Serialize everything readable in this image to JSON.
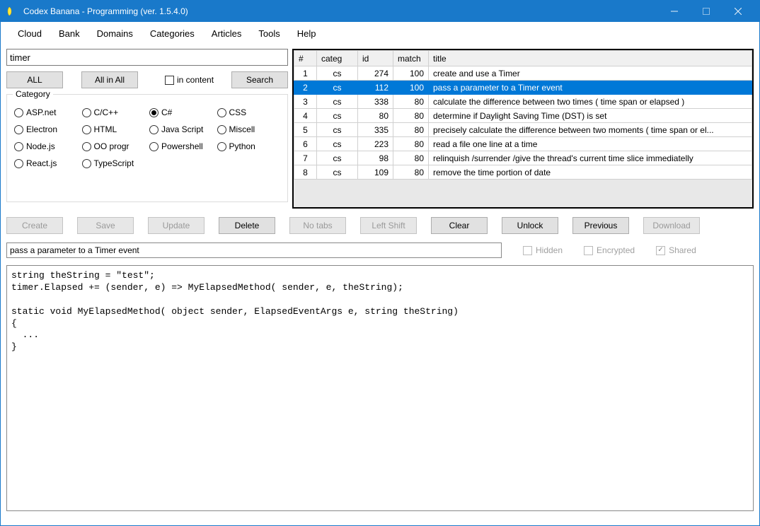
{
  "window": {
    "title": "Codex Banana - Programming  (ver. 1.5.4.0)"
  },
  "menu": [
    "Cloud",
    "Bank",
    "Domains",
    "Categories",
    "Articles",
    "Tools",
    "Help"
  ],
  "search": {
    "value": "timer",
    "all_btn": "ALL",
    "allinall_btn": "All in All",
    "in_content_label": "in content",
    "search_btn": "Search"
  },
  "category": {
    "legend": "Category",
    "items": [
      {
        "label": "ASP.net",
        "checked": false
      },
      {
        "label": "C/C++",
        "checked": false
      },
      {
        "label": "C#",
        "checked": true
      },
      {
        "label": "CSS",
        "checked": false
      },
      {
        "label": "Electron",
        "checked": false
      },
      {
        "label": "HTML",
        "checked": false
      },
      {
        "label": "Java Script",
        "checked": false
      },
      {
        "label": "Miscell",
        "checked": false
      },
      {
        "label": "Node.js",
        "checked": false
      },
      {
        "label": "OO progr",
        "checked": false
      },
      {
        "label": "Powershell",
        "checked": false
      },
      {
        "label": "Python",
        "checked": false
      },
      {
        "label": "React.js",
        "checked": false
      },
      {
        "label": "TypeScript",
        "checked": false
      }
    ]
  },
  "table": {
    "headers": {
      "n": "#",
      "categ": "categ",
      "id": "id",
      "match": "match",
      "title": "title"
    },
    "rows": [
      {
        "n": "1",
        "categ": "cs",
        "id": "274",
        "match": "100",
        "title": "create and use a Timer",
        "selected": false
      },
      {
        "n": "2",
        "categ": "cs",
        "id": "112",
        "match": "100",
        "title": "pass a parameter to a Timer event",
        "selected": true
      },
      {
        "n": "3",
        "categ": "cs",
        "id": "338",
        "match": "80",
        "title": "calculate the difference between two times ( time span or elapsed )",
        "selected": false
      },
      {
        "n": "4",
        "categ": "cs",
        "id": "80",
        "match": "80",
        "title": "determine if Daylight Saving Time (DST) is set",
        "selected": false
      },
      {
        "n": "5",
        "categ": "cs",
        "id": "335",
        "match": "80",
        "title": "precisely calculate the difference between two moments ( time span or el...",
        "selected": false
      },
      {
        "n": "6",
        "categ": "cs",
        "id": "223",
        "match": "80",
        "title": "read a file one line at a time",
        "selected": false
      },
      {
        "n": "7",
        "categ": "cs",
        "id": "98",
        "match": "80",
        "title": "relinquish /surrender /give the thread's current time slice immediatelly",
        "selected": false
      },
      {
        "n": "8",
        "categ": "cs",
        "id": "109",
        "match": "80",
        "title": "remove the time portion of date",
        "selected": false
      }
    ]
  },
  "actions": {
    "create": "Create",
    "save": "Save",
    "update": "Update",
    "delete": "Delete",
    "notabs": "No tabs",
    "leftshift": "Left Shift",
    "clear": "Clear",
    "unlock": "Unlock",
    "previous": "Previous",
    "download": "Download"
  },
  "detail": {
    "title_value": "pass a parameter to a Timer event",
    "hidden": "Hidden",
    "encrypted": "Encrypted",
    "shared": "Shared"
  },
  "code": "string theString = \"test\";\ntimer.Elapsed += (sender, e) => MyElapsedMethod( sender, e, theString);\n\nstatic void MyElapsedMethod( object sender, ElapsedEventArgs e, string theString)\n{\n  ...\n}"
}
